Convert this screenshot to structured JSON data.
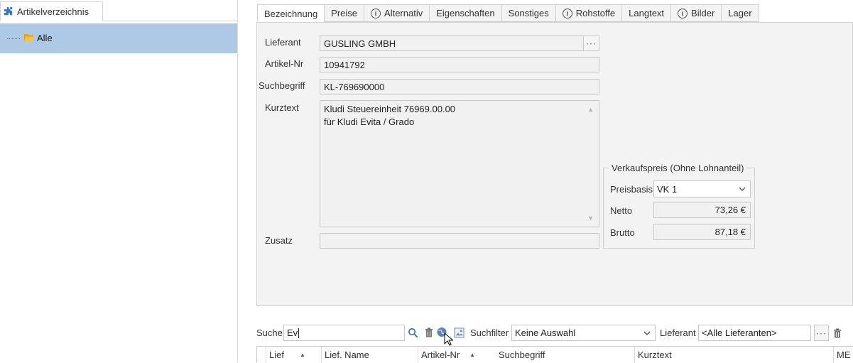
{
  "left_pane": {
    "tab_label": "Artikelverzeichnis",
    "tab_icon": "puzzle-icon",
    "tree_items": [
      {
        "label": "Alle",
        "icon": "folder-open-icon",
        "selected": true
      }
    ]
  },
  "tabs": [
    {
      "label": "Bezeichnung",
      "active": true,
      "info": false
    },
    {
      "label": "Preise",
      "active": false,
      "info": false
    },
    {
      "label": "Alternativ",
      "active": false,
      "info": true
    },
    {
      "label": "Eigenschaften",
      "active": false,
      "info": false
    },
    {
      "label": "Sonstiges",
      "active": false,
      "info": false
    },
    {
      "label": "Rohstoffe",
      "active": false,
      "info": true
    },
    {
      "label": "Langtext",
      "active": false,
      "info": false
    },
    {
      "label": "Bilder",
      "active": false,
      "info": true
    },
    {
      "label": "Lager",
      "active": false,
      "info": false
    }
  ],
  "form": {
    "lieferant_label": "Lieferant",
    "lieferant_value": "GUSLING GMBH",
    "lieferant_button": "···",
    "artikelnr_label": "Artikel-Nr",
    "artikelnr_value": "10941792",
    "suchbegriff_label": "Suchbegriff",
    "suchbegriff_value": "KL-769690000",
    "kurztext_label": "Kurztext",
    "kurztext_line1": "Kludi Steuereinheit 76969.00.00",
    "kurztext_line2": "für Kludi Evita / Grado",
    "zusatz_label": "Zusatz",
    "zusatz_value": ""
  },
  "price_group": {
    "title": "Verkaufspreis (Ohne Lohnanteil)",
    "preisbasis_label": "Preisbasis",
    "preisbasis_value": "VK 1",
    "netto_label": "Netto",
    "netto_value": "73,26 €",
    "brutto_label": "Brutto",
    "brutto_value": "87,18 €"
  },
  "search": {
    "suche_label": "Suche",
    "suche_value": "Ev",
    "suchfilter_label": "Suchfilter",
    "suchfilter_value": "Keine Auswahl",
    "lieferant_label": "Lieferant",
    "lieferant_value": "<Alle Lieferanten>",
    "lieferant_button": "···"
  },
  "grid": {
    "columns": [
      "Lief",
      "Lief. Name",
      "Artikel-Nr",
      "Suchbegriff",
      "Kurztext",
      "ME"
    ]
  },
  "colors": {
    "selection": "#aec9e6",
    "panel_bg": "#f3f3f3",
    "accent": "#3a78c2"
  }
}
